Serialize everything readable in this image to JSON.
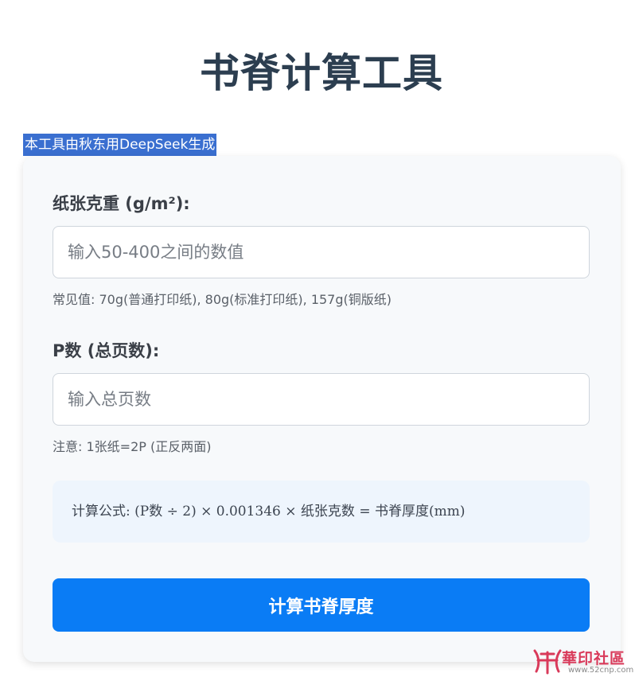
{
  "header": {
    "title": "书脊计算工具",
    "credit": "本工具由秋东用DeepSeek生成"
  },
  "form": {
    "gsm": {
      "label": "纸张克重 (g/m²):",
      "placeholder": "输入50-400之间的数值",
      "value": "",
      "hint": "常见值: 70g(普通打印纸), 80g(标准打印纸), 157g(铜版纸)"
    },
    "pages": {
      "label": "P数 (总页数):",
      "placeholder": "输入总页数",
      "value": "",
      "hint": "注意: 1张纸=2P (正反两面)"
    },
    "formula": "计算公式: (P数 ÷ 2) × 0.001346 × 纸张克数 = 书脊厚度(mm)",
    "button_label": "计算书脊厚度"
  },
  "watermark": {
    "text": "華印社區",
    "url": "www.52cnp.com"
  },
  "colors": {
    "title": "#2c3e50",
    "credit_bg": "#3a6fd0",
    "button_bg": "#0a7cf5",
    "formula_bg": "#eef5fd",
    "card_bg": "#f7f9fb"
  }
}
